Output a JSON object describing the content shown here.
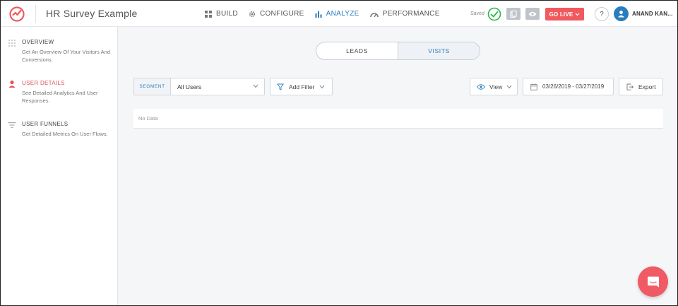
{
  "header": {
    "title": "HR Survey Example",
    "nav": [
      {
        "label": "BUILD",
        "icon": "grid-icon"
      },
      {
        "label": "CONFIGURE",
        "icon": "gear-icon"
      },
      {
        "label": "ANALYZE",
        "icon": "bar-chart-icon",
        "active": true
      },
      {
        "label": "PERFORMANCE",
        "icon": "speedometer-icon"
      }
    ],
    "saved_text": "Saved",
    "go_live_label": "GO LIVE",
    "help_label": "?",
    "user_name": "ANAND KAN..."
  },
  "sidebar": {
    "items": [
      {
        "title": "OVERVIEW",
        "description": "Get An Overview Of Your Visitors And Conversions.",
        "icon": "dots-grid-icon"
      },
      {
        "title": "USER DETAILS",
        "description": "See Detailed Analytics And User Responses.",
        "icon": "user-icon",
        "active": true
      },
      {
        "title": "USER FUNNELS",
        "description": "Get Detailed Metrics On User Flows.",
        "icon": "funnel-icon"
      }
    ]
  },
  "main": {
    "toggle": {
      "leads": "LEADS",
      "visits": "VISITS",
      "selected": "VISITS"
    },
    "segment": {
      "label": "SEGMENT",
      "value": "All Users"
    },
    "add_filter_label": "Add Filter",
    "view_label": "View",
    "date_range": "03/26/2019 - 03/27/2019",
    "export_label": "Export",
    "empty_text": "No Data"
  },
  "colors": {
    "accent_blue": "#2a7dbd",
    "brand_red": "#f05a5f",
    "saved_green": "#2db44a"
  }
}
